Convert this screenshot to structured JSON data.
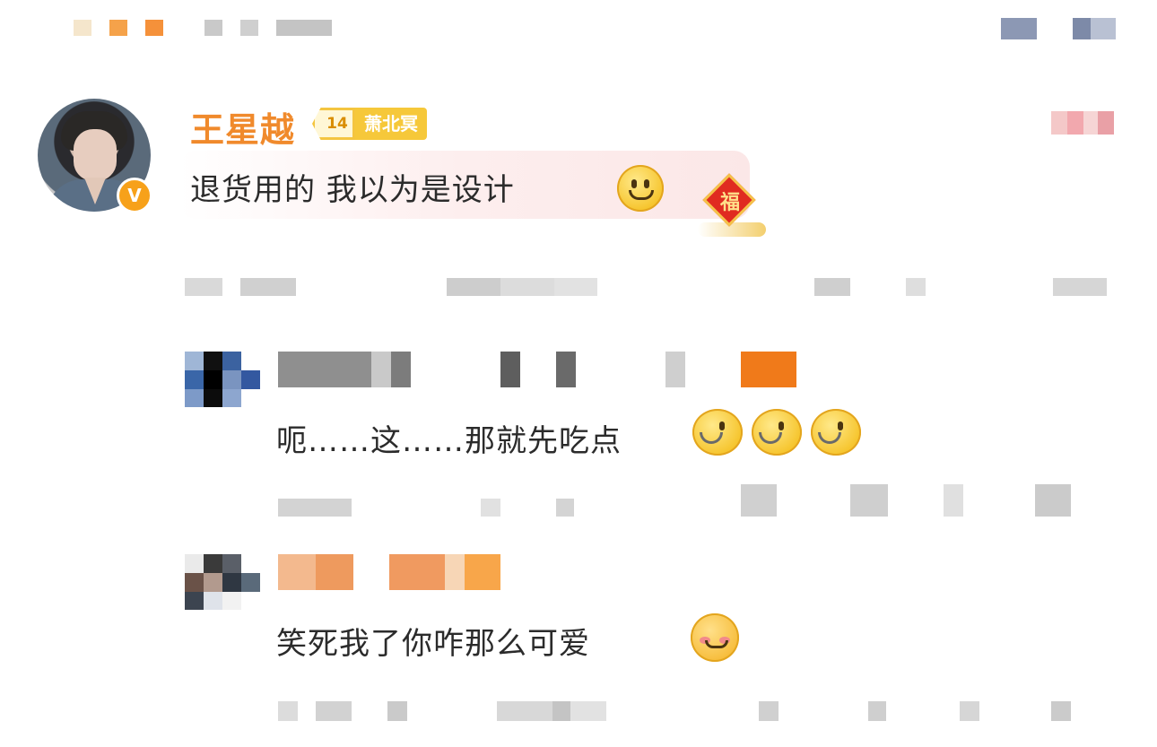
{
  "main_comment": {
    "author": "王星越",
    "fan_level": "14",
    "fan_club": "萧北冥",
    "text": "退货用的 我以为是设计",
    "verified": "V"
  },
  "replies": [
    {
      "text": "呃……这……那就先吃点"
    },
    {
      "text": "笑死我了你咋那么可爱"
    }
  ],
  "decoration": {
    "fu": "福"
  },
  "colors": {
    "author_name": "#f08a2c",
    "fan_badge": "#f6c83a",
    "verified_badge": "#f7a11a",
    "text": "#2b2b2b"
  },
  "icons": [
    "smile-emoji-icon",
    "eating-emoji-icon",
    "shy-emoji-icon",
    "fu-decoration-icon",
    "verified-icon"
  ]
}
